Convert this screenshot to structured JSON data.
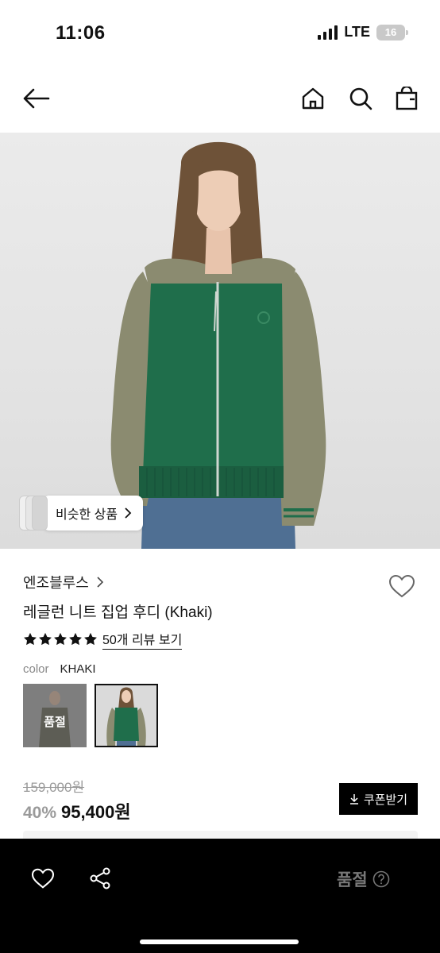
{
  "status_bar": {
    "time": "11:06",
    "network": "LTE",
    "battery": "16"
  },
  "top_nav": {
    "back_icon": "arrow-left-icon",
    "home_icon": "home-icon",
    "search_icon": "search-icon",
    "cart_icon": "shopping-bag-icon"
  },
  "hero": {
    "similar_button_label": "비슷한 상품"
  },
  "product": {
    "brand": "엔조블루스",
    "title": "레글런 니트 집업 후디 (Khaki)",
    "rating_stars": 5,
    "review_link": "50개 리뷰 보기",
    "color_label": "color",
    "color_value": "KHAKI",
    "swatches": [
      {
        "badge": "품절",
        "sold_out": true,
        "selected": false
      },
      {
        "badge": "",
        "sold_out": false,
        "selected": true
      }
    ],
    "original_price": "159,000원",
    "discount": "40%",
    "price": "95,400원",
    "coupon_button": "쿠폰받기"
  },
  "bottom_bar": {
    "sold_out_label": "품절",
    "help_icon": "question-circle-icon",
    "wish_icon": "heart-icon",
    "share_icon": "share-icon"
  },
  "colors": {
    "accent": "#000000",
    "muted": "#9a9a9a",
    "knit_green": "#1f6e4b",
    "knit_khaki": "#8b8b70"
  }
}
